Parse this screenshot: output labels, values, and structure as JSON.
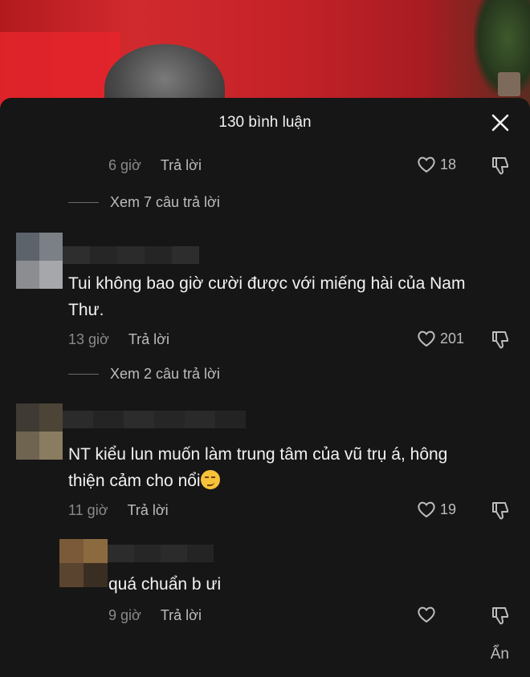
{
  "sheet": {
    "title": "130 bình luận"
  },
  "top_comment_meta": {
    "time": "6 giờ",
    "reply": "Trả lời",
    "likes": "18"
  },
  "view_replies_1": "Xem 7 câu trả lời",
  "comments": [
    {
      "text_line1": "Tui không bao giờ cười được với miếng hài của Nam",
      "text_line2": "Thư.",
      "time": "13 giờ",
      "reply": "Trả lời",
      "likes": "201",
      "view_replies": "Xem 2 câu trả lời"
    },
    {
      "text_line1": "NT kiểu lun muốn làm trung tâm của vũ trụ á, hông",
      "text_line2": "thiện cảm cho nổi",
      "emoji": "smirk-emoji",
      "time": "11 giờ",
      "reply": "Trả lời",
      "likes": "19"
    }
  ],
  "reply": {
    "text": "quá chuẩn b ưi",
    "time": "9 giờ",
    "reply": "Trả lời"
  },
  "hide_label": "Ẩn",
  "icons": [
    "close-icon",
    "heart-icon",
    "dislike-icon"
  ],
  "colors": {
    "sheet_bg": "#161616",
    "text": "#f2f2f2",
    "muted": "#8a8a8a"
  }
}
